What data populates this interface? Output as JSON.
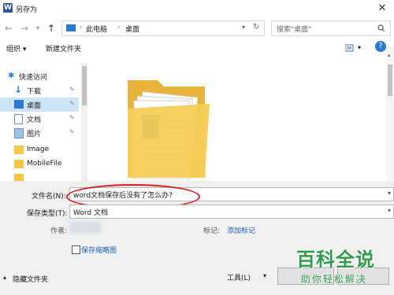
{
  "window": {
    "app_icon_letter": "W",
    "title": "另存为"
  },
  "address": {
    "crumbs": [
      "此电脑",
      "桌面"
    ],
    "search_placeholder": "搜索\"桌面\""
  },
  "toolbar": {
    "organize": "组织 ▾",
    "new_folder": "新建文件夹"
  },
  "sidebar": {
    "items": [
      {
        "label": "快速访问",
        "icon": "star-icon"
      },
      {
        "label": "下载",
        "icon": "download-icon"
      },
      {
        "label": "桌面",
        "icon": "desktop-icon"
      },
      {
        "label": "文档",
        "icon": "document-icon"
      },
      {
        "label": "图片",
        "icon": "picture-icon"
      },
      {
        "label": "Image",
        "icon": "folder-icon"
      },
      {
        "label": "MobileFile",
        "icon": "folder-icon"
      }
    ]
  },
  "form": {
    "filename_label": "文件名(N):",
    "filename_value": "word文档保存后没有了怎么办?",
    "type_label": "保存类型(T):",
    "type_value": "Word 文档",
    "author_label": "作者:",
    "tags_label": "标记:",
    "tags_link": "添加标记",
    "thumbnail_label": "保存缩略图",
    "hide_folders": "隐藏文件夹",
    "tools": "工具(L)",
    "tools_arrow": "▾"
  },
  "watermark": {
    "title": "百科全说",
    "subtitle": "助你轻松解决"
  },
  "colors": {
    "accent": "#2b79d6",
    "watermark": "#2e9c4a",
    "highlight_ring": "#d81e1e"
  }
}
